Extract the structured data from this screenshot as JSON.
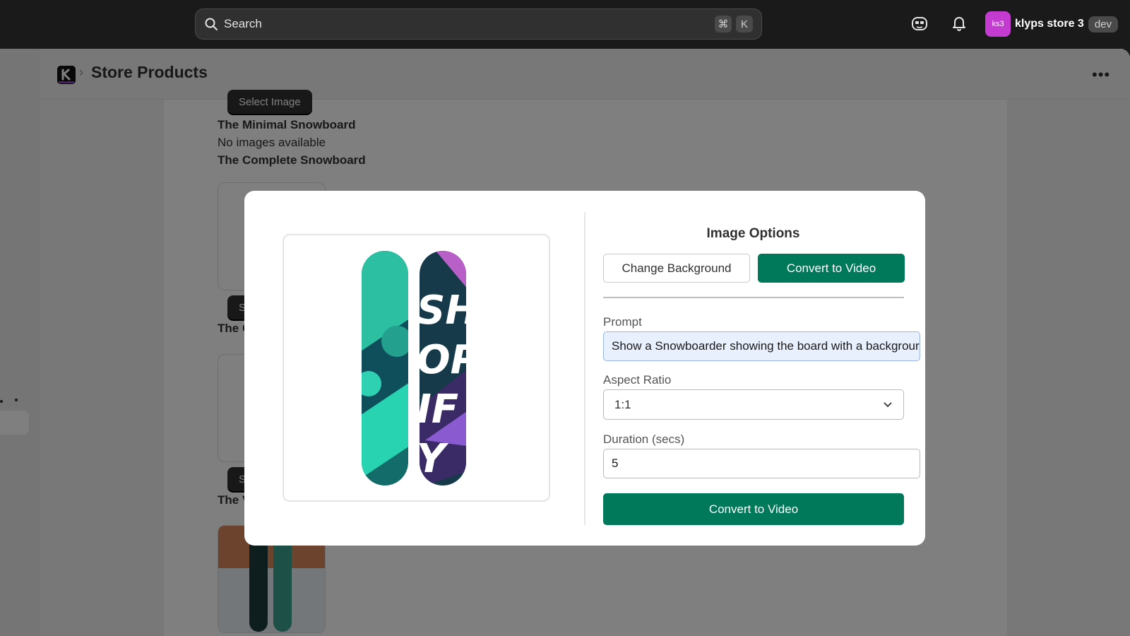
{
  "topbar": {
    "search_placeholder": "Search",
    "shortcut_keys": [
      "⌘",
      "K"
    ],
    "store_avatar": "ks3",
    "store_name": "klyps store 3",
    "env_badge": "dev"
  },
  "header": {
    "title": "Store Products",
    "more_label": "•••"
  },
  "products": {
    "select_image_label": "Select Image",
    "select_image_partial": "Select Im",
    "p1_title": "The Minimal Snowboard",
    "p1_status": "No images available",
    "p2_title": "The Complete Snowboard",
    "p3_title_partial": "The Compar",
    "p4_title_partial": "The Videogr"
  },
  "modal": {
    "title": "Image Options",
    "tabs": [
      "Change Background",
      "Convert to Video"
    ],
    "active_tab": "Convert to Video",
    "prompt_label": "Prompt",
    "prompt_value": "Show a Snowboarder showing the board with a backgrour",
    "aspect_label": "Aspect Ratio",
    "aspect_value": "1:1",
    "duration_label": "Duration (secs)",
    "duration_value": "5",
    "submit_label": "Convert to Video",
    "board_text": "SHOPIFY"
  },
  "colors": {
    "primary": "#00785a",
    "topbar_bg": "#1a1a1a",
    "avatar_bg": "#c43bd1"
  },
  "icons": [
    "search-icon",
    "ai-assistant-icon",
    "bell-icon",
    "app-logo",
    "chevron-right-icon",
    "more-icon",
    "chevron-down-icon"
  ]
}
